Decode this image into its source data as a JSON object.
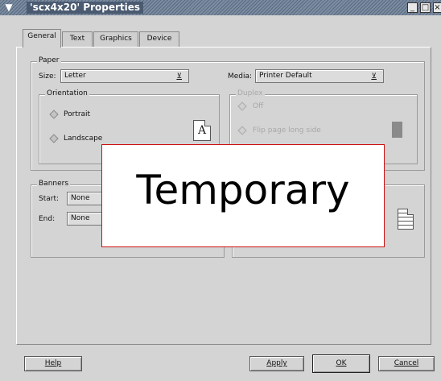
{
  "window": {
    "title": "'scx4x20' Properties",
    "buttons": [
      "_",
      "□",
      "×"
    ]
  },
  "tabs": [
    "General",
    "Text",
    "Graphics",
    "Device"
  ],
  "paper": {
    "label": "Paper",
    "size_label": "Size:",
    "size_value": "Letter",
    "media_label": "Media:",
    "media_value": "Printer Default"
  },
  "orientation": {
    "label": "Orientation",
    "options": [
      "Portrait",
      "Landscape"
    ]
  },
  "duplex": {
    "label": "Duplex",
    "options": [
      "Off",
      "Flip page long side"
    ]
  },
  "banners": {
    "label": "Banners",
    "start_label": "Start:",
    "start_value": "None",
    "end_label": "End:",
    "end_value": "None"
  },
  "overlay": {
    "text": "Temporary"
  },
  "footer": {
    "help": "Help",
    "apply": "Apply",
    "ok": "OK",
    "cancel": "Cancel"
  }
}
